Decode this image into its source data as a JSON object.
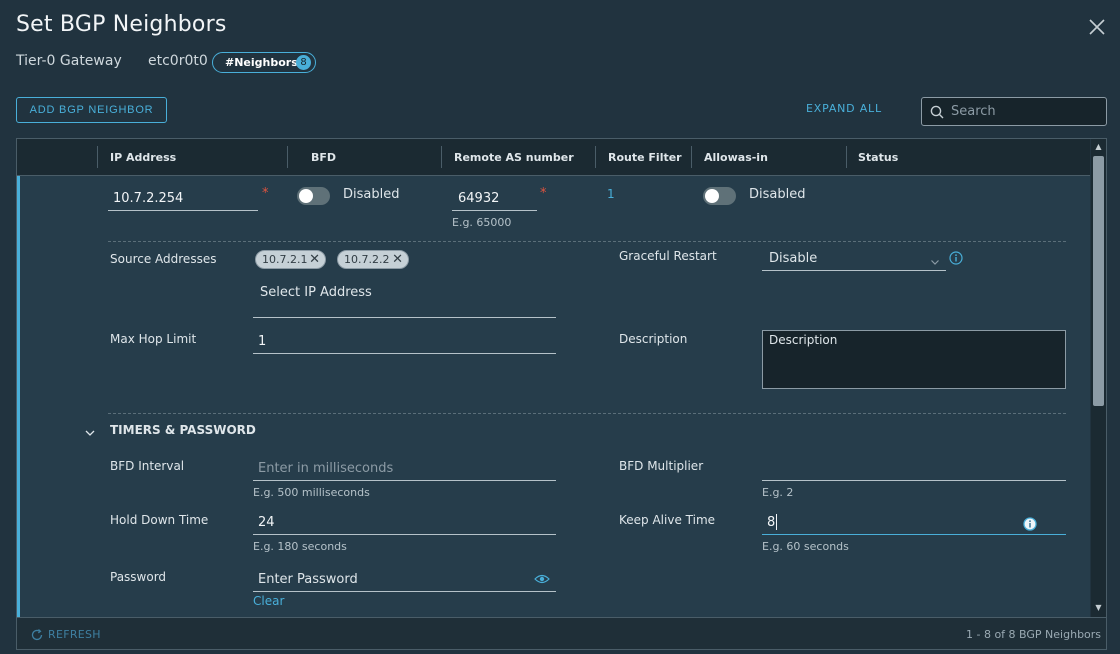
{
  "dialog": {
    "title": "Set BGP Neighbors",
    "gateway_label": "Tier-0 Gateway",
    "gateway_name": "etc0r0t0",
    "neighbors_badge": "#Neighbors",
    "neighbors_count": "8"
  },
  "toolbar": {
    "add_label": "ADD BGP NEIGHBOR",
    "expand_label": "EXPAND ALL",
    "search_placeholder": "Search"
  },
  "grid": {
    "columns": [
      "IP Address",
      "BFD",
      "Remote AS number",
      "Route Filter",
      "Allowas-in",
      "Status"
    ],
    "row": {
      "ip_address": "10.7.2.254",
      "bfd_state": "Disabled",
      "remote_as": "64932",
      "remote_as_hint": "E.g. 65000",
      "route_filter": "1",
      "allowas_state": "Disabled"
    }
  },
  "detail": {
    "source_label": "Source Addresses",
    "source_chips": [
      "10.7.2.1",
      "10.7.2.2"
    ],
    "source_placeholder": "Select IP Address",
    "graceful_label": "Graceful Restart",
    "graceful_value": "Disable",
    "max_hop_label": "Max Hop Limit",
    "max_hop_value": "1",
    "description_label": "Description",
    "description_placeholder": "Description",
    "timers_section": "TIMERS & PASSWORD",
    "bfd_interval_label": "BFD Interval",
    "bfd_interval_placeholder": "Enter in milliseconds",
    "bfd_interval_hint": "E.g. 500 milliseconds",
    "bfd_multiplier_label": "BFD Multiplier",
    "bfd_multiplier_hint": "E.g. 2",
    "hold_down_label": "Hold Down Time",
    "hold_down_value": "24",
    "hold_down_hint": "E.g. 180 seconds",
    "keep_alive_label": "Keep Alive Time",
    "keep_alive_value": "8",
    "keep_alive_hint": "E.g. 60 seconds",
    "password_label": "Password",
    "password_placeholder": "Enter Password",
    "clear_label": "Clear"
  },
  "footer": {
    "refresh_label": "REFRESH",
    "pager": "1 - 8 of 8 BGP Neighbors"
  },
  "colors": {
    "accent": "#49afd9",
    "background": "#21333f",
    "required": "#e0543f"
  }
}
